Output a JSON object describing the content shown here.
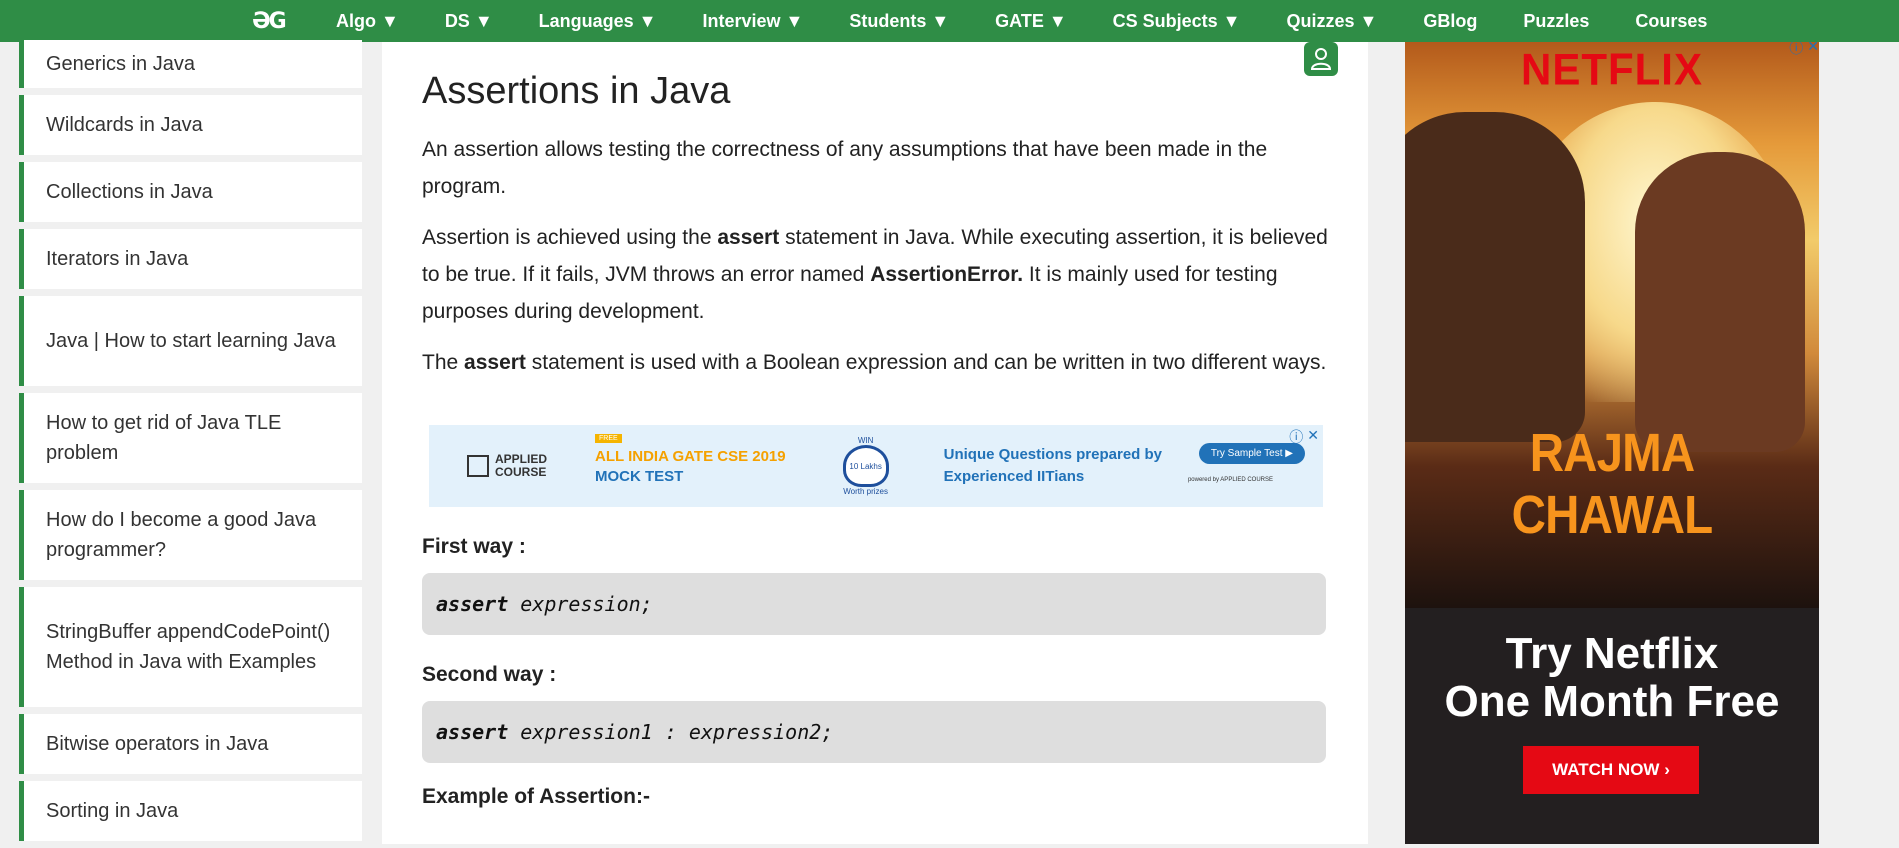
{
  "nav": {
    "logo": "ƏG",
    "items": [
      "Algo ▼",
      "DS ▼",
      "Languages ▼",
      "Interview ▼",
      "Students ▼",
      "GATE ▼",
      "CS Subjects ▼",
      "Quizzes ▼",
      "GBlog",
      "Puzzles",
      "Courses"
    ]
  },
  "sidebar": {
    "items": [
      "Generics in Java",
      "Wildcards in Java",
      "Collections in Java",
      "Iterators in Java",
      "Java | How to start learning Java",
      "How to get rid of Java TLE problem",
      "How do I become a good Java programmer?",
      "StringBuffer appendCodePoint() Method in Java with Examples",
      "Bitwise operators in Java",
      "Sorting in Java"
    ]
  },
  "article": {
    "title": "Assertions in Java",
    "p1": "An assertion allows testing the correctness of any assumptions that have been made in the program.",
    "p2_a": "Assertion is achieved using the ",
    "p2_b": "assert",
    "p2_c": " statement in Java. While executing assertion, it is believed to be true. If it fails, JVM throws an error named ",
    "p2_d": "AssertionError.",
    "p2_e": " It is mainly used for testing purposes during development.",
    "p3_a": "The ",
    "p3_b": "assert",
    "p3_c": " statement is used with a Boolean expression and can be written in two different ways.",
    "first_way": "First way :",
    "code1_kw": "assert",
    "code1_rest": "expression;",
    "second_way": "Second way :",
    "code2_kw": "assert",
    "code2_rest": "expression1 : expression2;",
    "example": "Example of Assertion:-"
  },
  "banner_ad": {
    "logo": "APPLIED\nCOURSE",
    "free": "FREE",
    "line1": "ALL INDIA GATE CSE 2019",
    "line2": "MOCK TEST",
    "win": "WIN",
    "prize": "10 Lakhs",
    "worth": "Worth prizes",
    "unique1": "Unique Questions prepared by",
    "unique2": "Experienced IITians",
    "cta": "Try Sample Test ▶",
    "powered": "powered by APPLIED COURSE"
  },
  "side_ad": {
    "brand": "NETFLIX",
    "movie": "RAJMA CHAWAL",
    "try_line1": "Try Netflix",
    "try_line2": "One Month Free",
    "watch": "WATCH NOW ›"
  },
  "colors": {
    "brand_green": "#2f8d46",
    "netflix_red": "#e50914",
    "ad_blue": "#2172b8"
  }
}
